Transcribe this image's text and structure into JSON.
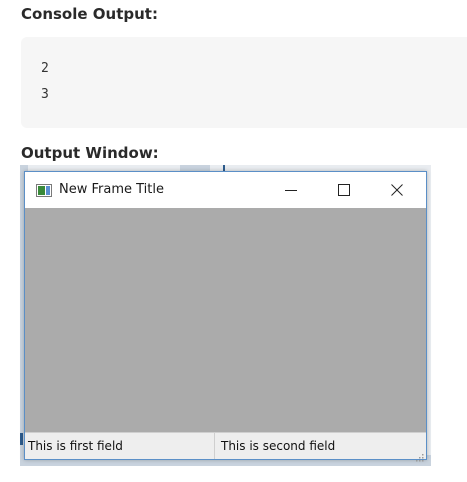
{
  "console": {
    "heading": "Console Output:",
    "lines": [
      "2",
      "3"
    ]
  },
  "output_window": {
    "heading": "Output Window:"
  },
  "frame": {
    "title": "New Frame Title",
    "controls": {
      "minimize_icon": "minimize-icon",
      "maximize_icon": "maximize-icon",
      "close_icon": "close-icon"
    },
    "content_color": "#ababab",
    "status_fields": [
      "This is first field",
      "This is second field"
    ]
  }
}
